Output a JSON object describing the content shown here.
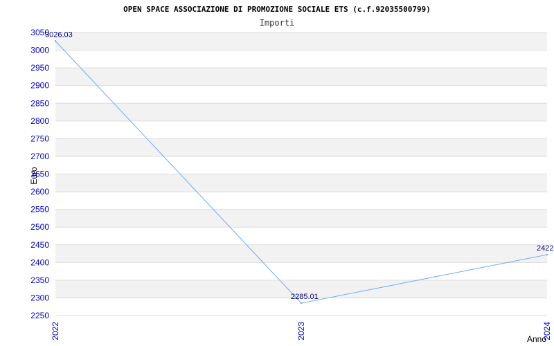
{
  "chart_data": {
    "type": "line",
    "title": "OPEN SPACE ASSOCIAZIONE DI PROMOZIONE SOCIALE ETS (c.f.92035500799)",
    "subtitle": "Importi",
    "xlabel": "Anno",
    "ylabel": "Euro",
    "categories": [
      "2022",
      "2023",
      "2024"
    ],
    "series": [
      {
        "values": [
          3026.03,
          2285.01,
          2422.0
        ]
      }
    ],
    "data_labels": [
      "3026.03",
      "2285.01",
      "2422.0"
    ],
    "ylim": [
      2250,
      3050
    ],
    "yticks": [
      2250,
      2300,
      2350,
      2400,
      2450,
      2500,
      2550,
      2600,
      2650,
      2700,
      2750,
      2800,
      2850,
      2900,
      2950,
      3000,
      3050
    ],
    "grid": true,
    "colors": {
      "line": "#6aaef0",
      "band": "#f2f2f2",
      "gridline": "#dddddd",
      "tick_text": "#0000cc",
      "data_label": "#000080"
    }
  }
}
